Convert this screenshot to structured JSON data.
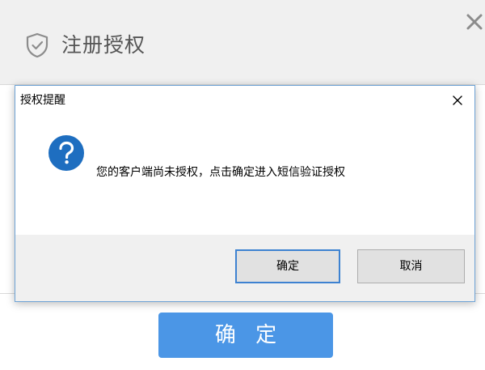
{
  "background_window": {
    "title": "注册授权",
    "icons": {
      "shield": "shield-check-icon",
      "close": "close-icon"
    },
    "confirm_label": "确 定",
    "colors": {
      "confirm_button": "#4b96e6",
      "header_bg": "#f0f0f0"
    }
  },
  "dialog": {
    "title": "授权提醒",
    "message": "您的客户端尚未授权，点击确定进入短信验证授权",
    "icons": {
      "question": "question-icon",
      "close": "close-icon"
    },
    "buttons": {
      "ok": "确定",
      "cancel": "取消"
    },
    "colors": {
      "question_icon": "#1e6ec0",
      "default_button_border": "#3d82d1"
    }
  }
}
